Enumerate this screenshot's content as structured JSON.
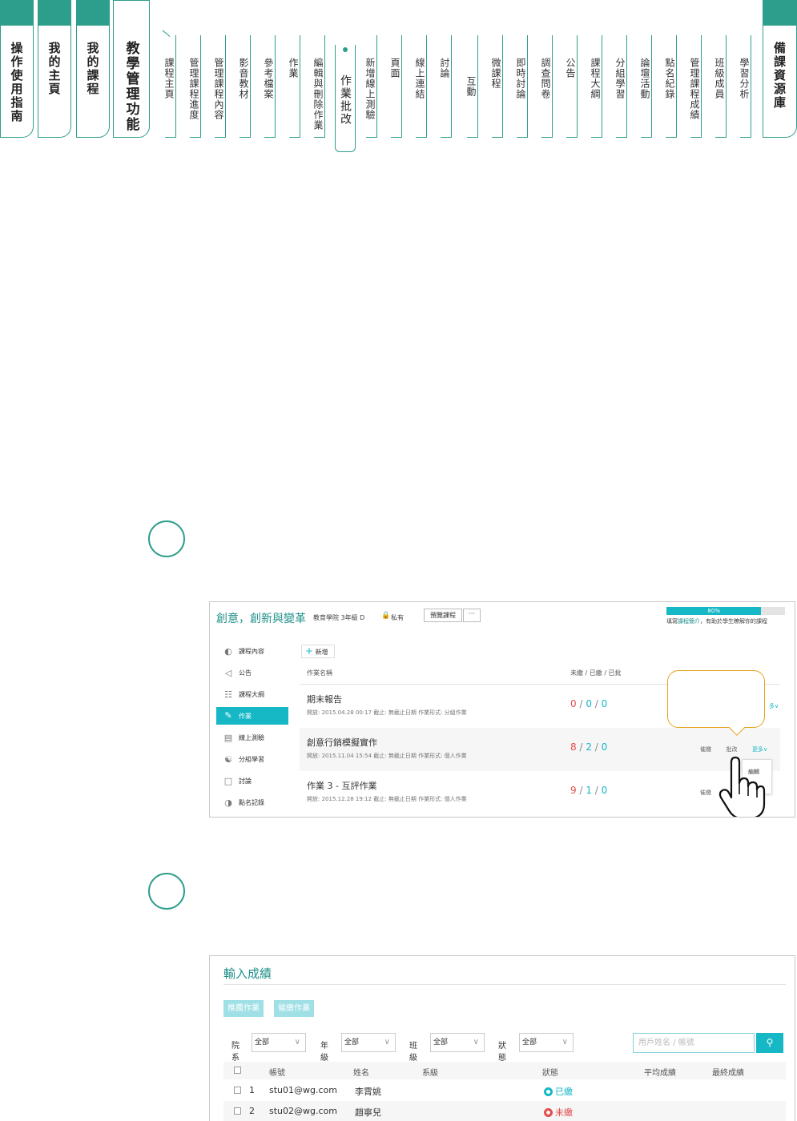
{
  "nav": {
    "main_tabs": [
      {
        "label": "操作使用指南"
      },
      {
        "label": "我的主頁"
      },
      {
        "label": "我的課程"
      },
      {
        "label": "教學管理功能"
      }
    ],
    "sub_tabs": [
      "課程主頁",
      "管理課程進度",
      "管理課程內容",
      "影音教材",
      "參考檔案",
      "作業",
      "編輯與刪除作業",
      "作業批改",
      "新增線上測驗",
      "頁面",
      "線上連結",
      "討論",
      "互動",
      "微課程",
      "即時討論",
      "調查問卷",
      "公告",
      "課程大綱",
      "分組學習",
      "論壇活動",
      "點名紀錄",
      "管理課程成績",
      "班級成員",
      "學習分析"
    ],
    "right_tab": "備課資源庫"
  },
  "shot1": {
    "course_title": "創意，創新與變革",
    "course_meta": "教育學院 3年級 D",
    "private_label": "私有",
    "preview_button": "預覽課程",
    "more_button": "···",
    "progress_percent": 80,
    "progress_label": "80%",
    "progress_tip_prefix": "填寫",
    "progress_tip_link": "課程簡介",
    "progress_tip_suffix": "，有助於學生瞭解你的課程",
    "sidebar": [
      {
        "label": "課程內容",
        "icon": "content-icon"
      },
      {
        "label": "公告",
        "icon": "megaphone-icon"
      },
      {
        "label": "課程大綱",
        "icon": "outline-icon"
      },
      {
        "label": "作業",
        "icon": "assignment-icon"
      },
      {
        "label": "線上測驗",
        "icon": "quiz-icon"
      },
      {
        "label": "分組學習",
        "icon": "group-icon"
      },
      {
        "label": "討論",
        "icon": "discussion-icon"
      },
      {
        "label": "點名記錄",
        "icon": "rollcall-icon"
      }
    ],
    "add_button": "新增",
    "col_name": "作業名稱",
    "col_count": "未繳 / 已繳 / 已批",
    "assignments": [
      {
        "name": "期末報告",
        "meta": "開放:  2015.04.28 00:17     截止:  無截止日期     作業形式:  分組作業",
        "unsubmitted": "0",
        "submitted": "0",
        "graded": "0",
        "actions": "更多"
      },
      {
        "name": "創意行銷模擬實作",
        "meta": "開放:  2015.11.04 15:54     截止:  無截止日期     作業形式:  個人作業",
        "unsubmitted": "8",
        "submitted": "2",
        "graded": "0",
        "remind": "催繳",
        "grade": "批改",
        "more": "更多"
      },
      {
        "name": "作業 3 - 互評作業",
        "meta": "開放:  2015.12.28 19:12     截止:  無截止日期     作業形式:  個人作業",
        "unsubmitted": "9",
        "submitted": "1",
        "graded": "0",
        "remind": "催繳"
      }
    ],
    "dropdown_item": "編輯"
  },
  "shot2": {
    "title": "輸入成績",
    "recommend_button": "推薦作業",
    "remind_button": "催繳作業",
    "filters": [
      {
        "label": "院系",
        "value": "全部"
      },
      {
        "label": "年級",
        "value": "全部"
      },
      {
        "label": "班級",
        "value": "全部"
      },
      {
        "label": "狀態",
        "value": "全部"
      }
    ],
    "search_placeholder": "用戶姓名 / 帳號",
    "columns": [
      "帳號",
      "姓名",
      "系級",
      "狀態",
      "平均成績",
      "最終成績"
    ],
    "rows": [
      {
        "no": "1",
        "account": "stu01@wg.com",
        "name": "李霄姚",
        "status": "已繳",
        "status_color": "#17b8c6"
      },
      {
        "no": "2",
        "account": "stu02@wg.com",
        "name": "趙寧兒",
        "status": "未繳",
        "status_color": "#e34b4b"
      }
    ]
  },
  "colors": {
    "accent": "#2e9e8c",
    "cyan": "#17b8c6",
    "orange": "#e8a21d",
    "red": "#e34b4b"
  }
}
